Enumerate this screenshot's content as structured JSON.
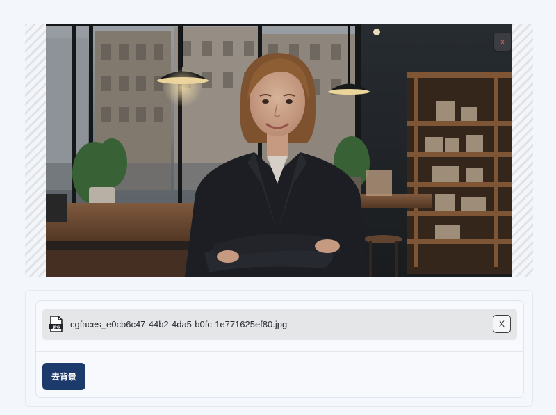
{
  "preview": {
    "image_description_icon": "portrait-photo",
    "remove_label": "x"
  },
  "file": {
    "icon": "jpg-file-icon",
    "icon_label": "JPG",
    "name": "cgfaces_e0cb6c47-44b2-4da5-b0fc-1e771625ef80.jpg",
    "remove_label": "X"
  },
  "actions": {
    "remove_background_label": "去背景"
  },
  "colors": {
    "primary_button": "#1d3a6c",
    "page_background": "#f3f6fb",
    "file_row_background": "#e5e6e8"
  }
}
